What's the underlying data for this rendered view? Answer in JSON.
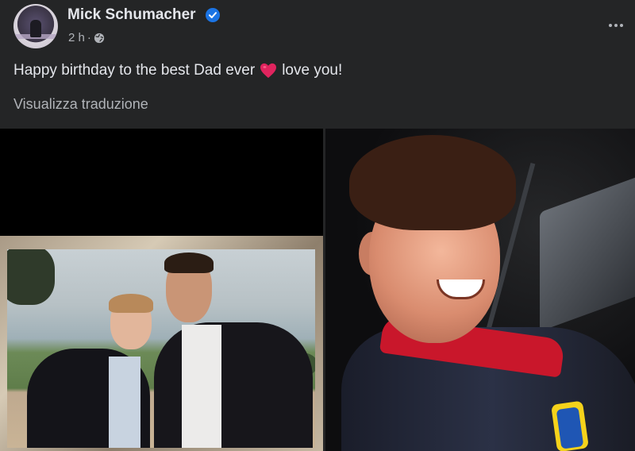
{
  "post": {
    "author": "Mick Schumacher",
    "time": "2 h",
    "separator": "·",
    "text_before_heart": "Happy birthday to the best Dad ever",
    "text_after_heart": "love you!",
    "translate_label": "Visualizza traduzione"
  },
  "icons": {
    "verified": "verified-badge-icon",
    "globe": "globe-icon",
    "more": "more-options-icon",
    "heart": "red-heart-emoji"
  },
  "colors": {
    "background": "#242526",
    "text": "#e4e6eb",
    "secondary_text": "#b0b3b8",
    "verified_blue": "#1b74e4",
    "heart_red": "#e0245e"
  }
}
